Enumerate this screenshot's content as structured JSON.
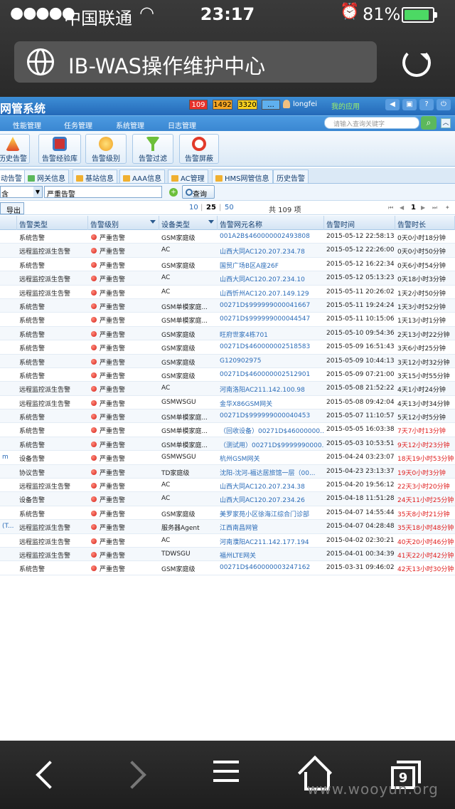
{
  "status": {
    "signal": "●●●●●",
    "carrier": "中国联通",
    "time": "23:17",
    "battery": "81%"
  },
  "browser": {
    "page_title": "IB-WAS操作维护中心"
  },
  "app": {
    "title": "网管系统",
    "counts": {
      "critical": "109",
      "major": "1492",
      "minor": "3320",
      "warning": "..."
    },
    "username": "longfei",
    "my_apps": "我的应用",
    "menu": [
      "性能管理",
      "任务管理",
      "系统管理",
      "日志管理"
    ],
    "search_placeholder": "请输入查询关键字",
    "tools": [
      "历史告警",
      "告警经验库",
      "告警级别",
      "告警过滤",
      "告警屏蔽"
    ],
    "subtabs": [
      "动告警",
      "网关信息",
      "基站信息",
      "AAA信息",
      "AC管理",
      "HMS网管信息",
      "历史告警"
    ],
    "filter": {
      "select_value": "含",
      "text_value": "严重告警",
      "query": "查询"
    },
    "pager": {
      "export": "导出",
      "sizes": [
        "10",
        "25",
        "50"
      ],
      "total": "共 109 项",
      "page": "1"
    },
    "columns": [
      "告警类型",
      "告警级别",
      "设备类型",
      "告警网元名称",
      "告警时间",
      "告警时长"
    ],
    "rows": [
      {
        "c0": "",
        "type": "系统告警",
        "level": "严重告警",
        "dev": "GSM家庭级",
        "name": "001A2B$460000002493808",
        "time": "2015-05-12 22:58:13",
        "dur": "0天0小时18分钟",
        "late": false
      },
      {
        "c0": "",
        "type": "远程监控派生告警",
        "level": "严重告警",
        "dev": "AC",
        "name": "山西大同AC120.207.234.78",
        "time": "2015-05-12 22:26:00",
        "dur": "0天0小时50分钟",
        "late": false
      },
      {
        "c0": "",
        "type": "系统告警",
        "level": "严重告警",
        "dev": "GSM家庭级",
        "name": "国贸广场B区A座26F",
        "time": "2015-05-12 16:22:34",
        "dur": "0天6小时54分钟",
        "late": false
      },
      {
        "c0": "",
        "type": "远程监控派生告警",
        "level": "严重告警",
        "dev": "AC",
        "name": "山西大同AC120.207.234.10",
        "time": "2015-05-12 05:13:23",
        "dur": "0天18小时3分钟",
        "late": false
      },
      {
        "c0": "",
        "type": "远程监控派生告警",
        "level": "严重告警",
        "dev": "AC",
        "name": "山西忻州AC120.207.149.129",
        "time": "2015-05-11 20:26:02",
        "dur": "1天2小时50分钟",
        "late": false
      },
      {
        "c0": "",
        "type": "系统告警",
        "level": "严重告警",
        "dev": "GSM单模家庭...",
        "name": "00271D$999999000041667",
        "time": "2015-05-11 19:24:24",
        "dur": "1天3小时52分钟",
        "late": false
      },
      {
        "c0": "",
        "type": "系统告警",
        "level": "严重告警",
        "dev": "GSM单模家庭...",
        "name": "00271D$999999000044547",
        "time": "2015-05-11 10:15:06",
        "dur": "1天13小时1分钟",
        "late": false
      },
      {
        "c0": "",
        "type": "系统告警",
        "level": "严重告警",
        "dev": "GSM家庭级",
        "name": "旺府世家4栋701",
        "time": "2015-05-10 09:54:36",
        "dur": "2天13小时22分钟",
        "late": false
      },
      {
        "c0": "",
        "type": "系统告警",
        "level": "严重告警",
        "dev": "GSM家庭级",
        "name": "00271D$460000002518583",
        "time": "2015-05-09 16:51:43",
        "dur": "3天6小时25分钟",
        "late": false
      },
      {
        "c0": "",
        "type": "系统告警",
        "level": "严重告警",
        "dev": "GSM家庭级",
        "name": "G120902975",
        "time": "2015-05-09 10:44:13",
        "dur": "3天12小时32分钟",
        "late": false
      },
      {
        "c0": "",
        "type": "系统告警",
        "level": "严重告警",
        "dev": "GSM家庭级",
        "name": "00271D$460000002512901",
        "time": "2015-05-09 07:21:00",
        "dur": "3天15小时55分钟",
        "late": false
      },
      {
        "c0": "",
        "type": "远程监控派生告警",
        "level": "严重告警",
        "dev": "AC",
        "name": "河南洛阳AC211.142.100.98",
        "time": "2015-05-08 21:52:22",
        "dur": "4天1小时24分钟",
        "late": false
      },
      {
        "c0": "",
        "type": "远程监控派生告警",
        "level": "严重告警",
        "dev": "GSMWSGU",
        "name": "金华X86GSM网关",
        "time": "2015-05-08 09:42:04",
        "dur": "4天13小时34分钟",
        "late": false
      },
      {
        "c0": "",
        "type": "系统告警",
        "level": "严重告警",
        "dev": "GSM单模家庭...",
        "name": "00271D$999999000040453",
        "time": "2015-05-07 11:10:57",
        "dur": "5天12小时5分钟",
        "late": false
      },
      {
        "c0": "",
        "type": "系统告警",
        "level": "严重告警",
        "dev": "GSM单模家庭...",
        "name": "（回收设备）00271D$46000000...",
        "time": "2015-05-05 16:03:38",
        "dur": "7天7小时13分钟",
        "late": true
      },
      {
        "c0": "",
        "type": "系统告警",
        "level": "严重告警",
        "dev": "GSM单模家庭...",
        "name": "（测试用）00271D$9999990000...",
        "time": "2015-05-03 10:53:51",
        "dur": "9天12小时23分钟",
        "late": true
      },
      {
        "c0": "m",
        "type": "设备告警",
        "level": "严重告警",
        "dev": "GSMWSGU",
        "name": "杭州GSM网关",
        "time": "2015-04-24 03:23:07",
        "dur": "18天19小时53分钟",
        "late": true
      },
      {
        "c0": "",
        "type": "协议告警",
        "level": "严重告警",
        "dev": "TD家庭级",
        "name": "沈阳-沈河-福达居旅馆一层（00...",
        "time": "2015-04-23 23:13:37",
        "dur": "19天0小时3分钟",
        "late": true
      },
      {
        "c0": "",
        "type": "远程监控派生告警",
        "level": "严重告警",
        "dev": "AC",
        "name": "山西大同AC120.207.234.38",
        "time": "2015-04-20 19:56:12",
        "dur": "22天3小时20分钟",
        "late": true
      },
      {
        "c0": "",
        "type": "设备告警",
        "level": "严重告警",
        "dev": "AC",
        "name": "山西大同AC120.207.234.26",
        "time": "2015-04-18 11:51:28",
        "dur": "24天11小时25分钟",
        "late": true
      },
      {
        "c0": "",
        "type": "系统告警",
        "level": "严重告警",
        "dev": "GSM家庭级",
        "name": "美罗家苑小区徐海江综合门诊部",
        "time": "2015-04-07 14:55:44",
        "dur": "35天8小时21分钟",
        "late": true
      },
      {
        "c0": "(T...",
        "type": "远程监控派生告警",
        "level": "严重告警",
        "dev": "服务器Agent",
        "name": "江西南昌网管",
        "time": "2015-04-07 04:28:48",
        "dur": "35天18小时48分钟",
        "late": true
      },
      {
        "c0": "",
        "type": "远程监控派生告警",
        "level": "严重告警",
        "dev": "AC",
        "name": "河南濮阳AC211.142.177.194",
        "time": "2015-04-02 02:30:21",
        "dur": "40天20小时46分钟",
        "late": true
      },
      {
        "c0": "",
        "type": "远程监控派生告警",
        "level": "严重告警",
        "dev": "TDWSGU",
        "name": "福州LTE网关",
        "time": "2015-04-01 00:34:39",
        "dur": "41天22小时42分钟",
        "late": true
      },
      {
        "c0": "",
        "type": "系统告警",
        "level": "严重告警",
        "dev": "GSM家庭级",
        "name": "00271D$460000003247162",
        "time": "2015-03-31 09:46:02",
        "dur": "42天13小时30分钟",
        "late": true
      }
    ]
  },
  "bottombar": {
    "tab_count": "9"
  },
  "watermark": "www.wooyun.org"
}
